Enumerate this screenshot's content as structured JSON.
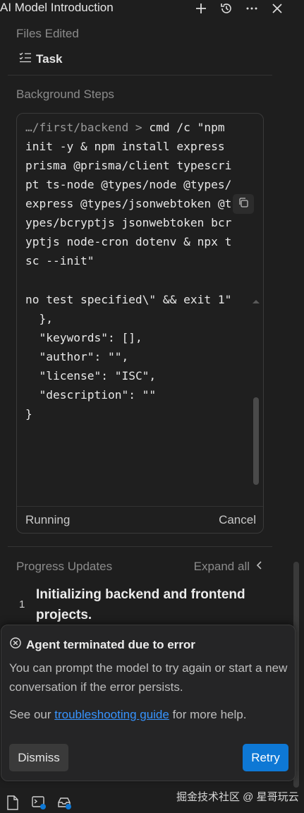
{
  "window": {
    "title": "AI Model Introduction",
    "actions": [
      {
        "name": "new-icon"
      },
      {
        "name": "history-icon"
      },
      {
        "name": "more-icon"
      },
      {
        "name": "close-icon"
      }
    ]
  },
  "files_edited": {
    "heading": "Files Edited",
    "task_label": "Task"
  },
  "background_steps": {
    "heading": "Background Steps",
    "command": {
      "prompt": "…/first/backend >",
      "text": " cmd /c \"npm init -y & npm install express prisma @prisma/client typescript ts-node @types/node @types/express @types/jsonwebtoken @types/bcryptjs jsonwebtoken bcryptjs node-cron dotenv & npx tsc --init\""
    },
    "output": "no test specified\\\" && exit 1\"\n  },\n  \"keywords\": [],\n  \"author\": \"\",\n  \"license\": \"ISC\",\n  \"description\": \"\"\n}",
    "status": "Running",
    "cancel_label": "Cancel"
  },
  "progress": {
    "heading": "Progress Updates",
    "expand_label": "Expand all",
    "steps": [
      {
        "number": "1",
        "text": "Initializing backend and frontend projects."
      }
    ]
  },
  "error_toast": {
    "title": "Agent terminated due to error",
    "message": "You can prompt the model to try again or start a new conversation if the error persists.",
    "help_prefix": "See our ",
    "help_link": "troubleshooting guide",
    "help_suffix": " for more help.",
    "dismiss_label": "Dismiss",
    "retry_label": "Retry"
  },
  "bottom_bar": {
    "icons": [
      "file-icon",
      "terminal-icon",
      "inbox-icon"
    ]
  },
  "watermark": "掘金技术社区 @ 星哥玩云",
  "colors": {
    "background": "#1e1e1e",
    "accent": "#0e78d5",
    "link": "#3794ff"
  }
}
